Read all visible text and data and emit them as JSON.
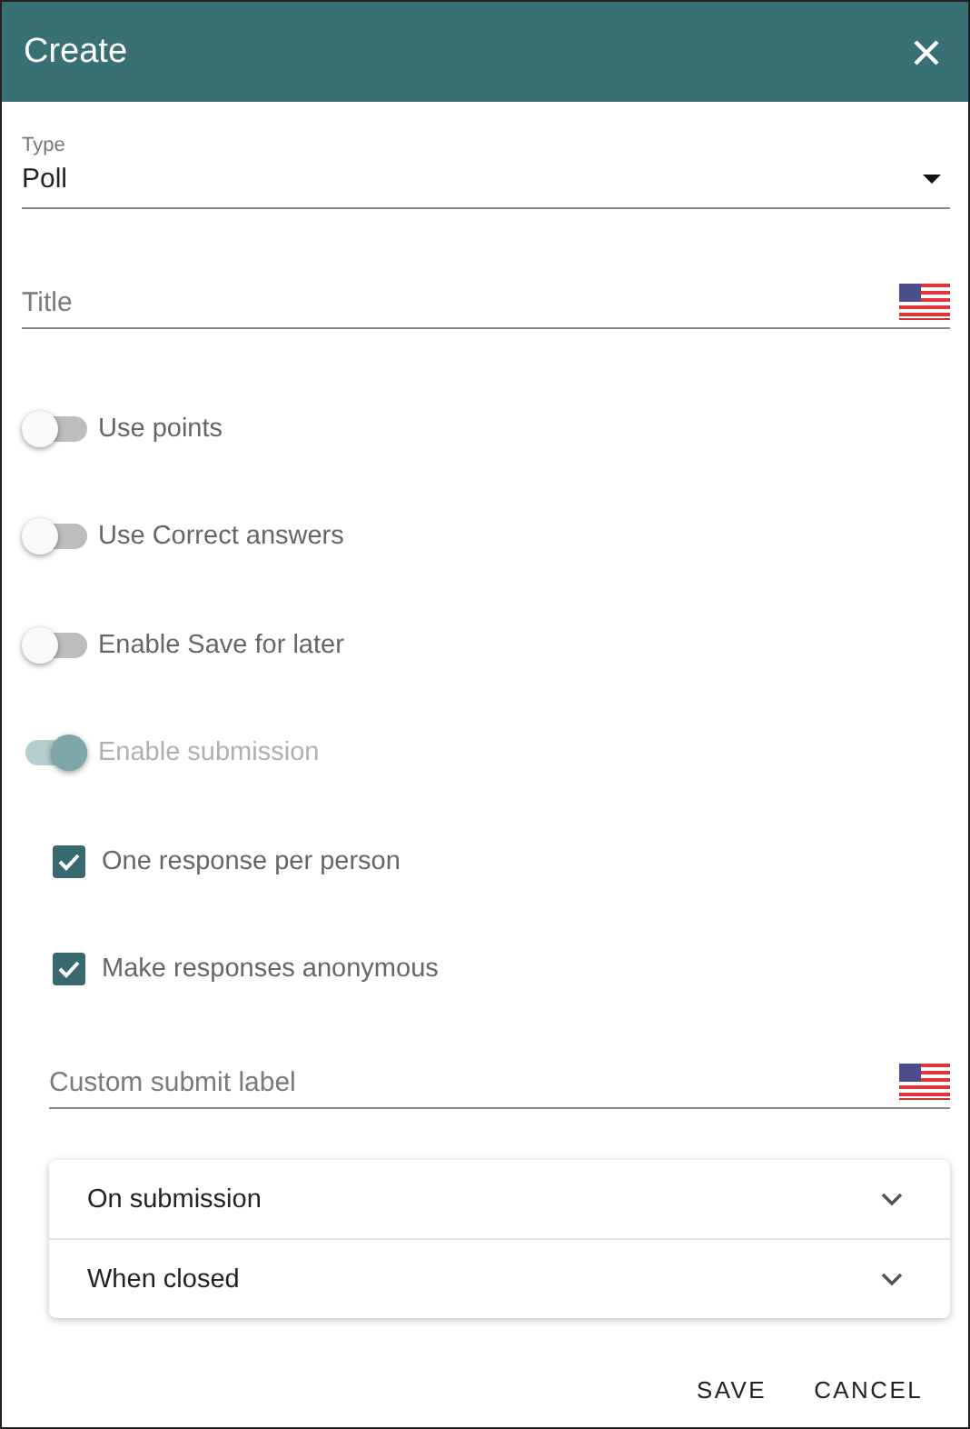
{
  "window": {
    "title": "Create"
  },
  "type_field": {
    "label": "Type",
    "value": "Poll"
  },
  "title_field": {
    "placeholder": "Title"
  },
  "toggles": [
    {
      "label": "Use points",
      "on": false,
      "disabled": false
    },
    {
      "label": "Use Correct answers",
      "on": false,
      "disabled": false
    },
    {
      "label": "Enable Save for later",
      "on": false,
      "disabled": false
    },
    {
      "label": "Enable submission",
      "on": true,
      "disabled": true
    }
  ],
  "checkboxes": [
    {
      "label": "One response per person",
      "checked": true
    },
    {
      "label": "Make responses anonymous",
      "checked": true
    }
  ],
  "submit_label_field": {
    "placeholder": "Custom submit label"
  },
  "panels": [
    {
      "label": "On submission",
      "expanded": false
    },
    {
      "label": "When closed",
      "expanded": false
    }
  ],
  "buttons": [
    "SAVE",
    "CANCEL"
  ]
}
